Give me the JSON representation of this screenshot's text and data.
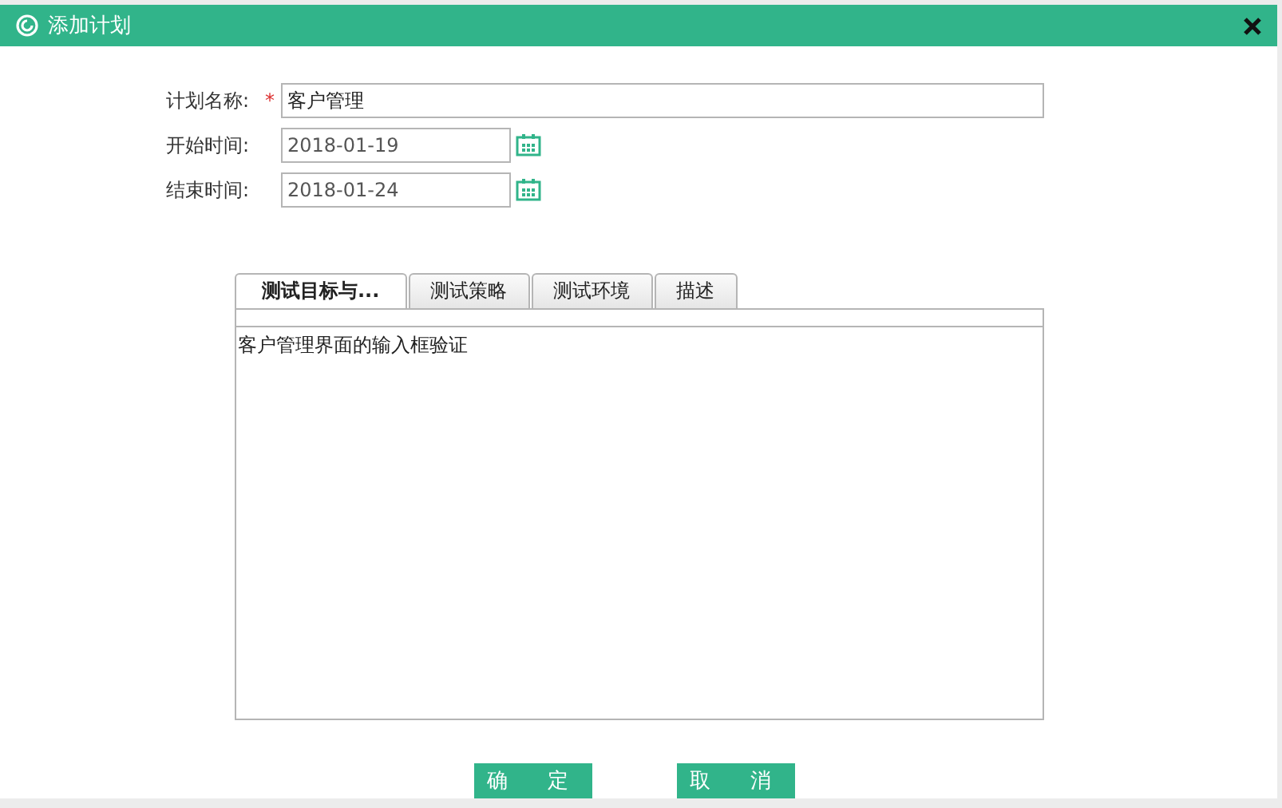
{
  "window": {
    "title": "添加计划"
  },
  "form": [
    {
      "kind": "text",
      "label": "计划名称:",
      "required_mark": "*",
      "value": "客户管理"
    },
    {
      "kind": "date",
      "label": "开始时间:",
      "value": "2018-01-19"
    },
    {
      "kind": "date",
      "label": "结束时间:",
      "value": "2018-01-24"
    }
  ],
  "tabs": [
    {
      "label": "测试目标与...",
      "selected": true
    },
    {
      "label": "测试策略",
      "selected": false
    },
    {
      "label": "测试环境",
      "selected": false
    },
    {
      "label": "描述",
      "selected": false
    }
  ],
  "content": {
    "value": "客户管理界面的输入框验证"
  },
  "buttons": [
    "确　定",
    "取　消"
  ]
}
